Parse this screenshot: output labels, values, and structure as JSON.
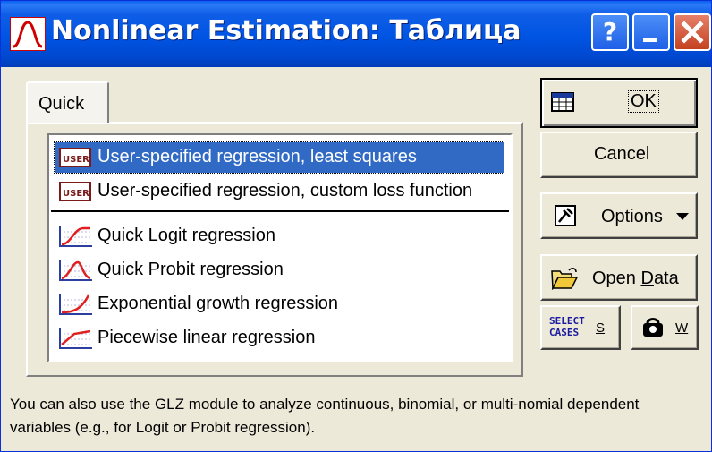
{
  "window": {
    "title": "Nonlinear Estimation: Таблица",
    "help_glyph": "?"
  },
  "tabs": [
    {
      "label": "Quick",
      "active": true
    }
  ],
  "list": {
    "items": [
      {
        "label": "User-specified regression, least squares",
        "icon": "user-icon",
        "selected": true
      },
      {
        "label": "User-specified regression, custom loss function",
        "icon": "user-icon",
        "selected": false
      },
      {
        "label": "Quick Logit regression",
        "icon": "logit-curve-icon",
        "selected": false
      },
      {
        "label": "Quick Probit regression",
        "icon": "probit-curve-icon",
        "selected": false
      },
      {
        "label": "Exponential growth regression",
        "icon": "exponential-curve-icon",
        "selected": false
      },
      {
        "label": "Piecewise linear regression",
        "icon": "piecewise-curve-icon",
        "selected": false
      }
    ]
  },
  "buttons": {
    "ok": "OK",
    "cancel": "Cancel",
    "options": "Options",
    "open_data_prefix": "Open ",
    "open_data_underlined": "D",
    "open_data_suffix": "ata",
    "select_cases_line1": "SELECT",
    "select_cases_line2": "CASES",
    "select_cases_key": "S",
    "weight_key": "W"
  },
  "note": "You can also use the GLZ module to analyze continuous, binomial, or multi-nomial dependent variables (e.g., for Logit or Probit regression).",
  "colors": {
    "titlebar": "#0054e3",
    "selection": "#316ac5",
    "close_button": "#c4421f",
    "dialog_bg": "#ece9d8"
  }
}
